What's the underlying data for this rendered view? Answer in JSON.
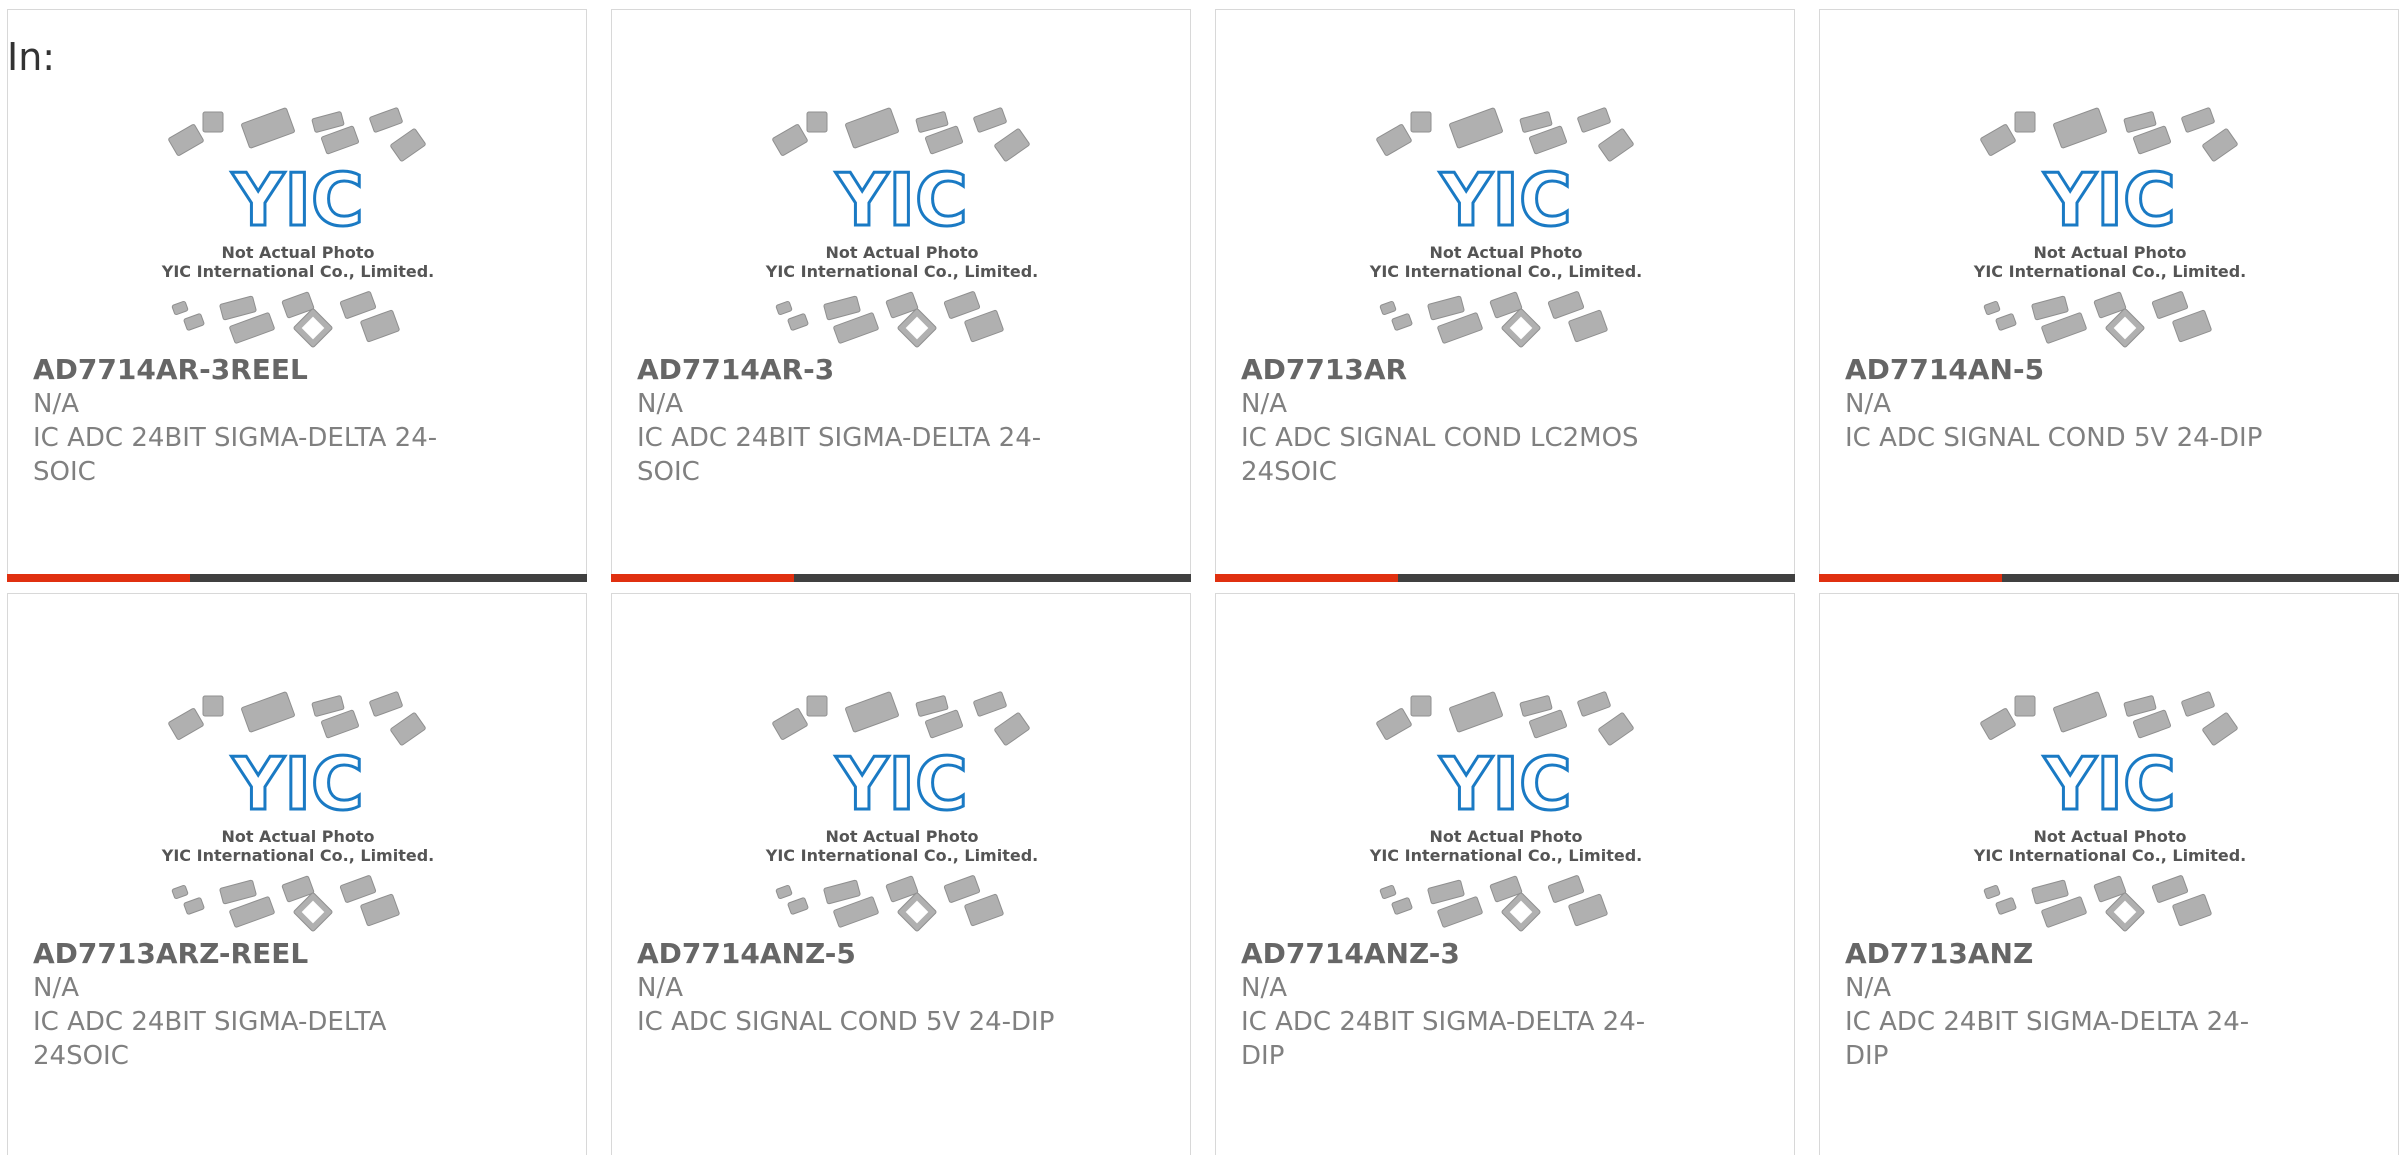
{
  "header": {
    "label": "In:"
  },
  "placeholder": {
    "caption_line1": "Not Actual Photo",
    "caption_line2": "YIC International Co., Limited.",
    "logo_text": "YIC"
  },
  "colors": {
    "accent": "#e03010",
    "bar_dark": "#404040",
    "logo_blue": "#1a7ac4",
    "text_gray": "#808080"
  },
  "products": [
    {
      "part": "AD7714AR-3REEL",
      "mfr": "N/A",
      "desc": "IC ADC 24BIT SIGMA-DELTA 24-SOIC"
    },
    {
      "part": "AD7714AR-3",
      "mfr": "N/A",
      "desc": "IC ADC 24BIT SIGMA-DELTA 24-SOIC"
    },
    {
      "part": "AD7713AR",
      "mfr": "N/A",
      "desc": "IC ADC SIGNAL COND LC2MOS 24SOIC"
    },
    {
      "part": "AD7714AN-5",
      "mfr": "N/A",
      "desc": "IC ADC SIGNAL COND 5V 24-DIP"
    },
    {
      "part": "AD7713ARZ-REEL",
      "mfr": "N/A",
      "desc": "IC ADC 24BIT SIGMA-DELTA 24SOIC"
    },
    {
      "part": "AD7714ANZ-5",
      "mfr": "N/A",
      "desc": "IC ADC SIGNAL COND 5V 24-DIP"
    },
    {
      "part": "AD7714ANZ-3",
      "mfr": "N/A",
      "desc": "IC ADC 24BIT SIGMA-DELTA 24-DIP"
    },
    {
      "part": "AD7713ANZ",
      "mfr": "N/A",
      "desc": "IC ADC 24BIT SIGMA-DELTA 24-DIP"
    }
  ]
}
